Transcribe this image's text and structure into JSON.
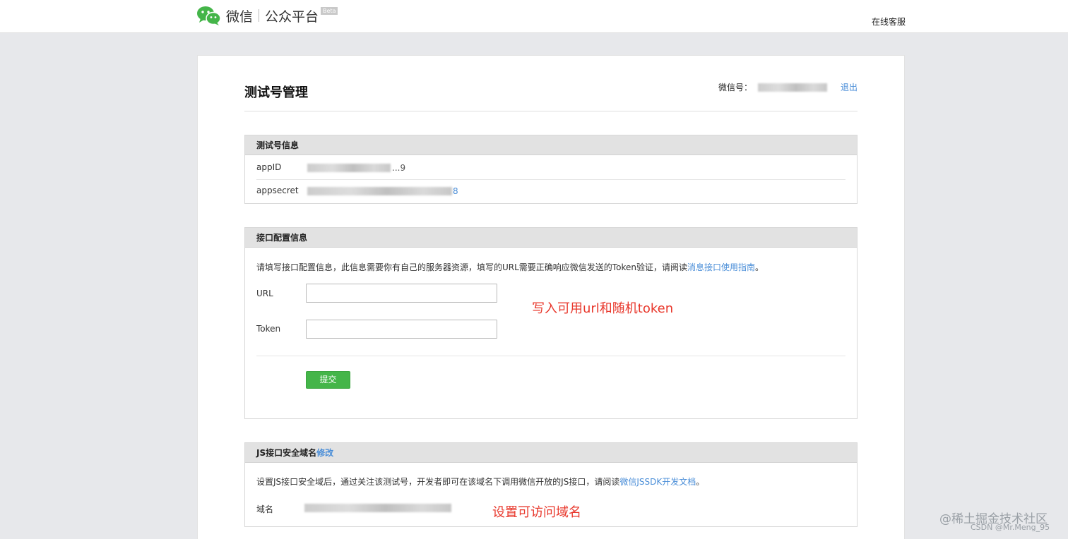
{
  "header": {
    "brand": "微信",
    "platform": "公众平台",
    "beta_badge": "Beta",
    "support_link": "在线客服"
  },
  "page": {
    "title": "测试号管理",
    "account_label": "微信号：",
    "logout_label": "退出"
  },
  "test_info": {
    "heading": "测试号信息",
    "appid_label": "appID",
    "appid_visible_tail": "...9",
    "appsecret_label": "appsecret",
    "appsecret_visible_tail": "8"
  },
  "interface_config": {
    "heading": "接口配置信息",
    "description_prefix": "请填写接口配置信息，此信息需要你有自己的服务器资源，填写的URL需要正确响应微信发送的Token验证，请阅读",
    "description_link": "消息接口使用指南",
    "description_suffix": "。",
    "url_label": "URL",
    "url_value": "",
    "token_label": "Token",
    "token_value": "",
    "submit_label": "提交",
    "annotation": "写入可用url和随机token"
  },
  "js_domain": {
    "heading": "JS接口安全域名",
    "edit_link": "修改",
    "description_prefix": "设置JS接口安全域后，通过关注该测试号，开发者即可在该域名下调用微信开放的JS接口，请阅读",
    "description_link": "微信JSSDK开发文档",
    "description_suffix": "。",
    "domain_label": "域名",
    "annotation": "设置可访问域名"
  },
  "watermark": {
    "line1": "@稀土掘金技术社区",
    "line2": "CSDN @Mr.Meng_95"
  },
  "colors": {
    "link": "#4a8ed8",
    "submit_button": "#44b549",
    "annotation": "#e8372b",
    "page_background": "#e7e8eb"
  }
}
